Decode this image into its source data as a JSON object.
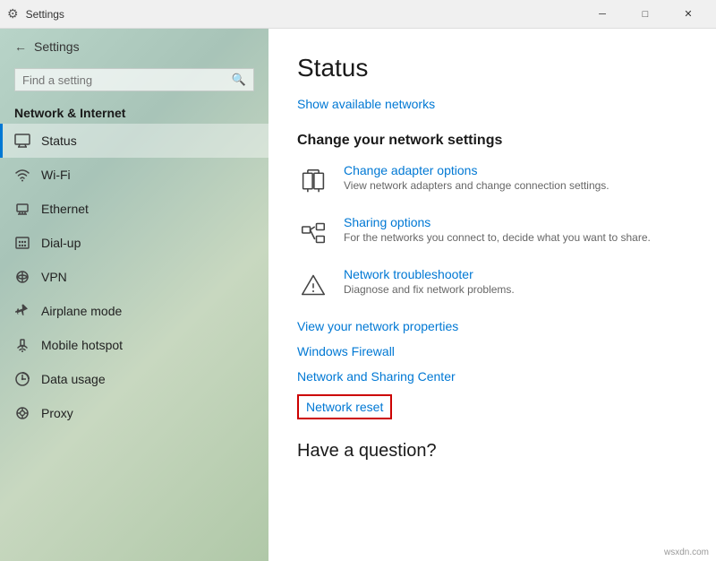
{
  "titleBar": {
    "title": "Settings",
    "minimizeLabel": "─",
    "maximizeLabel": "□",
    "closeLabel": "✕"
  },
  "sidebar": {
    "backLabel": "Settings",
    "search": {
      "placeholder": "Find a setting",
      "value": ""
    },
    "sectionTitle": "Network & Internet",
    "items": [
      {
        "id": "status",
        "label": "Status",
        "icon": "monitor",
        "active": true
      },
      {
        "id": "wifi",
        "label": "Wi-Fi",
        "icon": "wifi"
      },
      {
        "id": "ethernet",
        "label": "Ethernet",
        "icon": "ethernet"
      },
      {
        "id": "dialup",
        "label": "Dial-up",
        "icon": "dialup"
      },
      {
        "id": "vpn",
        "label": "VPN",
        "icon": "vpn"
      },
      {
        "id": "airplane",
        "label": "Airplane mode",
        "icon": "airplane"
      },
      {
        "id": "hotspot",
        "label": "Mobile hotspot",
        "icon": "hotspot"
      },
      {
        "id": "datausage",
        "label": "Data usage",
        "icon": "data"
      },
      {
        "id": "proxy",
        "label": "Proxy",
        "icon": "proxy"
      }
    ]
  },
  "main": {
    "pageTitle": "Status",
    "showNetworksLink": "Show available networks",
    "changeSectionTitle": "Change your network settings",
    "settings": [
      {
        "id": "adapter",
        "name": "Change adapter options",
        "desc": "View network adapters and change connection settings."
      },
      {
        "id": "sharing",
        "name": "Sharing options",
        "desc": "For the networks you connect to, decide what you want to share."
      },
      {
        "id": "troubleshoot",
        "name": "Network troubleshooter",
        "desc": "Diagnose and fix network problems."
      }
    ],
    "links": [
      {
        "id": "network-properties",
        "label": "View your network properties"
      },
      {
        "id": "windows-firewall",
        "label": "Windows Firewall"
      }
    ],
    "networkSharingCenterLink": "Network and Sharing Center",
    "networkResetLink": "Network reset",
    "haveQuestionTitle": "Have a question?"
  },
  "watermark": "wsxdn.com"
}
